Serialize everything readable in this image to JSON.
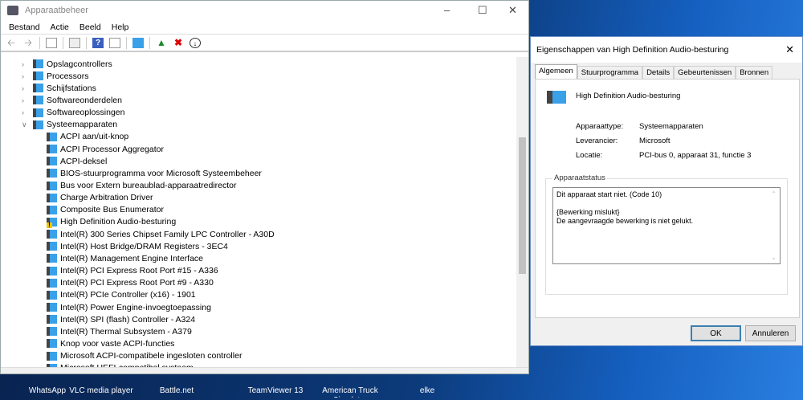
{
  "main_window": {
    "title": "Apparaatbeheer",
    "menu": [
      "Bestand",
      "Actie",
      "Beeld",
      "Help"
    ],
    "tree": [
      {
        "label": "Opslagcontrollers",
        "level": 1,
        "expanded": false
      },
      {
        "label": "Processors",
        "level": 1,
        "expanded": false
      },
      {
        "label": "Schijfstations",
        "level": 1,
        "expanded": false
      },
      {
        "label": "Softwareonderdelen",
        "level": 1,
        "expanded": false
      },
      {
        "label": "Softwareoplossingen",
        "level": 1,
        "expanded": false
      },
      {
        "label": "Systeemapparaten",
        "level": 1,
        "expanded": true
      },
      {
        "label": "ACPI aan/uit-knop",
        "level": 2
      },
      {
        "label": "ACPI Processor Aggregator",
        "level": 2
      },
      {
        "label": "ACPI-deksel",
        "level": 2
      },
      {
        "label": "BIOS-stuurprogramma voor Microsoft Systeembeheer",
        "level": 2
      },
      {
        "label": "Bus voor Extern bureaublad-apparaatredirector",
        "level": 2
      },
      {
        "label": "Charge Arbitration Driver",
        "level": 2
      },
      {
        "label": "Composite Bus Enumerator",
        "level": 2
      },
      {
        "label": "High Definition Audio-besturing",
        "level": 2,
        "warning": true
      },
      {
        "label": "Intel(R) 300 Series Chipset Family LPC Controller - A30D",
        "level": 2
      },
      {
        "label": "Intel(R) Host Bridge/DRAM Registers - 3EC4",
        "level": 2
      },
      {
        "label": "Intel(R) Management Engine Interface",
        "level": 2
      },
      {
        "label": "Intel(R) PCI Express Root Port #15 - A336",
        "level": 2
      },
      {
        "label": "Intel(R) PCI Express Root Port #9 - A330",
        "level": 2
      },
      {
        "label": "Intel(R) PCIe Controller (x16) - 1901",
        "level": 2
      },
      {
        "label": "Intel(R) Power Engine-invoegtoepassing",
        "level": 2
      },
      {
        "label": "Intel(R) SPI (flash) Controller - A324",
        "level": 2
      },
      {
        "label": "Intel(R) Thermal Subsystem - A379",
        "level": 2
      },
      {
        "label": "Knop voor vaste ACPI-functies",
        "level": 2
      },
      {
        "label": "Microsoft ACPI-compatibele ingesloten controller",
        "level": 2
      },
      {
        "label": "Microsoft UEFI-compatibel systeem",
        "level": 2
      }
    ]
  },
  "dialog": {
    "title": "Eigenschappen van High Definition Audio-besturing",
    "tabs": [
      "Algemeen",
      "Stuurprogramma",
      "Details",
      "Gebeurtenissen",
      "Bronnen"
    ],
    "device_name": "High Definition Audio-besturing",
    "fields": [
      {
        "label": "Apparaattype:",
        "value": "Systeemapparaten"
      },
      {
        "label": "Leverancier:",
        "value": "Microsoft"
      },
      {
        "label": "Locatie:",
        "value": "PCI-bus 0, apparaat 31, functie 3"
      }
    ],
    "status_label": "Apparaatstatus",
    "status_lines": [
      "Dit apparaat start niet. (Code 10)",
      "",
      "{Bewerking mislukt}",
      "De aangevraagde bewerking is niet gelukt."
    ],
    "ok": "OK",
    "cancel": "Annuleren"
  },
  "taskbar": [
    "WhatsApp",
    "VLC media player",
    "Battle.net",
    "TeamViewer 13",
    "American Truck Simulator",
    "elke"
  ]
}
